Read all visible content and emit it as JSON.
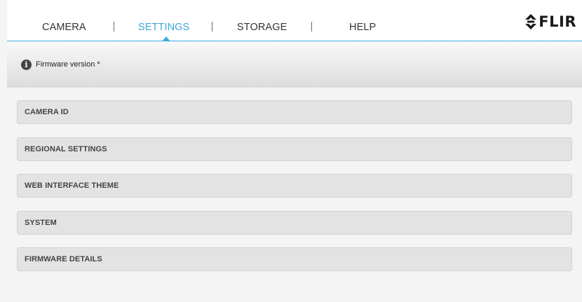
{
  "nav": {
    "items": [
      {
        "label": "CAMERA",
        "active": false
      },
      {
        "label": "SETTINGS",
        "active": true
      },
      {
        "label": "STORAGE",
        "active": false
      },
      {
        "label": "HELP",
        "active": false
      }
    ]
  },
  "logo": {
    "text": "FLIR",
    "icon": "flir-diamond-logo"
  },
  "info_bar": {
    "icon": "info-icon",
    "text": "Firmware version *"
  },
  "sections": [
    {
      "label": "CAMERA ID"
    },
    {
      "label": "REGIONAL SETTINGS"
    },
    {
      "label": "WEB INTERFACE THEME"
    },
    {
      "label": "SYSTEM"
    },
    {
      "label": "FIRMWARE DETAILS"
    }
  ],
  "colors": {
    "accent": "#3aa8d8",
    "background": "#f4f4f4",
    "section_bg": "#e3e3e3",
    "text": "#333333"
  }
}
